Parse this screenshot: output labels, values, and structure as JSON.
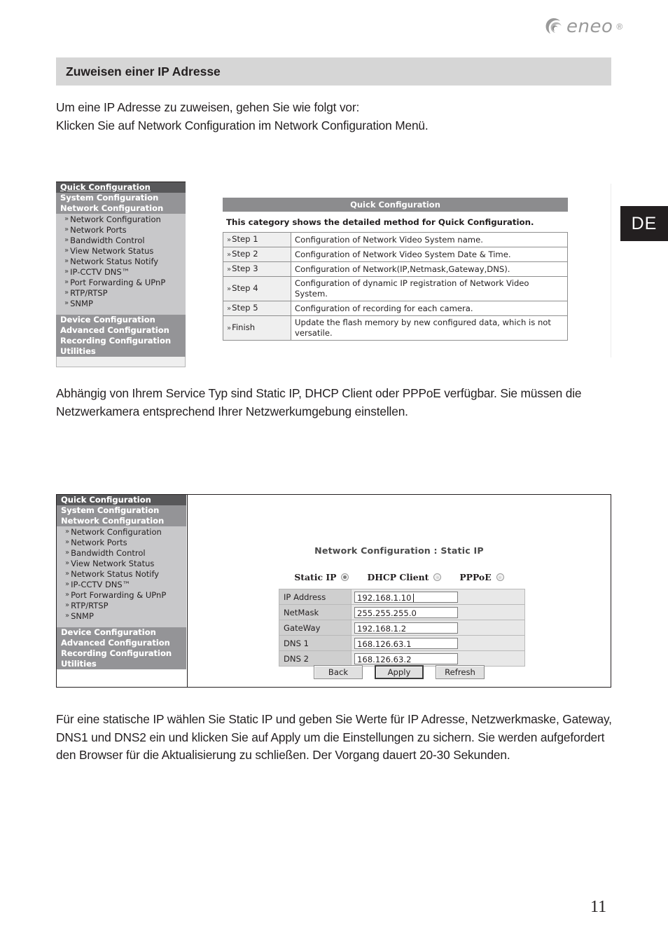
{
  "brand": {
    "name": "eneo",
    "trademark": "®",
    "logo_icon": "eneo-swirl-logo"
  },
  "language_tab": {
    "label": "DE"
  },
  "page": {
    "number": "11"
  },
  "section": {
    "title": "Zuweisen einer IP Adresse"
  },
  "paragraphs": {
    "intro": "Um eine IP Adresse zu zuweisen, gehen Sie wie folgt vor:\nKlicken Sie auf Network Configuration im Network Configuration Menü.",
    "middle": "Abhängig von Ihrem Service Typ sind Static IP, DHCP Client oder PPPoE verfügbar. Sie müssen die Netzwerkamera entsprechend Ihrer Netzwerkumgebung einstellen.",
    "bottom": "Für eine statische IP wählen Sie Static IP und geben Sie Werte für IP Adresse, Netzwerkmaske, Gateway, DNS1 und DNS2 ein und klicken Sie auf Apply um die Einstellungen zu sichern. Sie werden aufgefordert den Browser für die Aktualisierung zu schließen. Der Vorgang dauert 20-30 Sekunden."
  },
  "nav": {
    "categories": {
      "quick": "Quick Configuration",
      "system": "System Configuration",
      "network": "Network Configuration",
      "device": "Device Configuration",
      "advanced": "Advanced Configuration",
      "recording": "Recording Configuration",
      "utilities": "Utilities"
    },
    "chevron": "»",
    "subitems": [
      "Network Configuration",
      "Network Ports",
      "Bandwidth Control",
      "View Network Status",
      "Network Status Notify",
      "IP-CCTV DNS™",
      "Port Forwarding & UPnP",
      "RTP/RTSP",
      "SNMP"
    ]
  },
  "screenshot1": {
    "panel_title": "Quick Configuration",
    "description": "This category shows the detailed method for Quick Configuration.",
    "rows": [
      {
        "step": "Step 1",
        "desc": "Configuration of Network Video System name."
      },
      {
        "step": "Step 2",
        "desc": "Configuration of Network Video System Date & Time."
      },
      {
        "step": "Step 3",
        "desc": "Configuration of Network(IP,Netmask,Gateway,DNS)."
      },
      {
        "step": "Step 4",
        "desc": "Configuration of dynamic IP registration of Network Video System."
      },
      {
        "step": "Step 5",
        "desc": "Configuration of recording for each camera."
      },
      {
        "step": "Finish",
        "desc": "Update the flash memory by new configured data, which is not versatile."
      }
    ]
  },
  "screenshot2": {
    "panel_title": "Network Configuration : Static IP",
    "service_types": [
      {
        "label": "Static IP",
        "selected": true
      },
      {
        "label": "DHCP Client",
        "selected": false
      },
      {
        "label": "PPPoE",
        "selected": false
      }
    ],
    "fields": [
      {
        "label": "IP Address",
        "value": "192.168.1.10"
      },
      {
        "label": "NetMask",
        "value": "255.255.255.0"
      },
      {
        "label": "GateWay",
        "value": "192.168.1.2"
      },
      {
        "label": "DNS 1",
        "value": "168.126.63.1"
      },
      {
        "label": "DNS 2",
        "value": "168.126.63.2"
      }
    ],
    "buttons": [
      {
        "label": "Back",
        "focused": false
      },
      {
        "label": "Apply",
        "focused": true
      },
      {
        "label": "Refresh",
        "focused": false
      }
    ]
  },
  "colors": {
    "header_bar": "#d6d6d6",
    "nav_dark": "#58585a",
    "nav_mid": "#949497",
    "nav_sub": "#c8c8ca",
    "text": "#231f20",
    "tab_bg": "#231f20"
  }
}
